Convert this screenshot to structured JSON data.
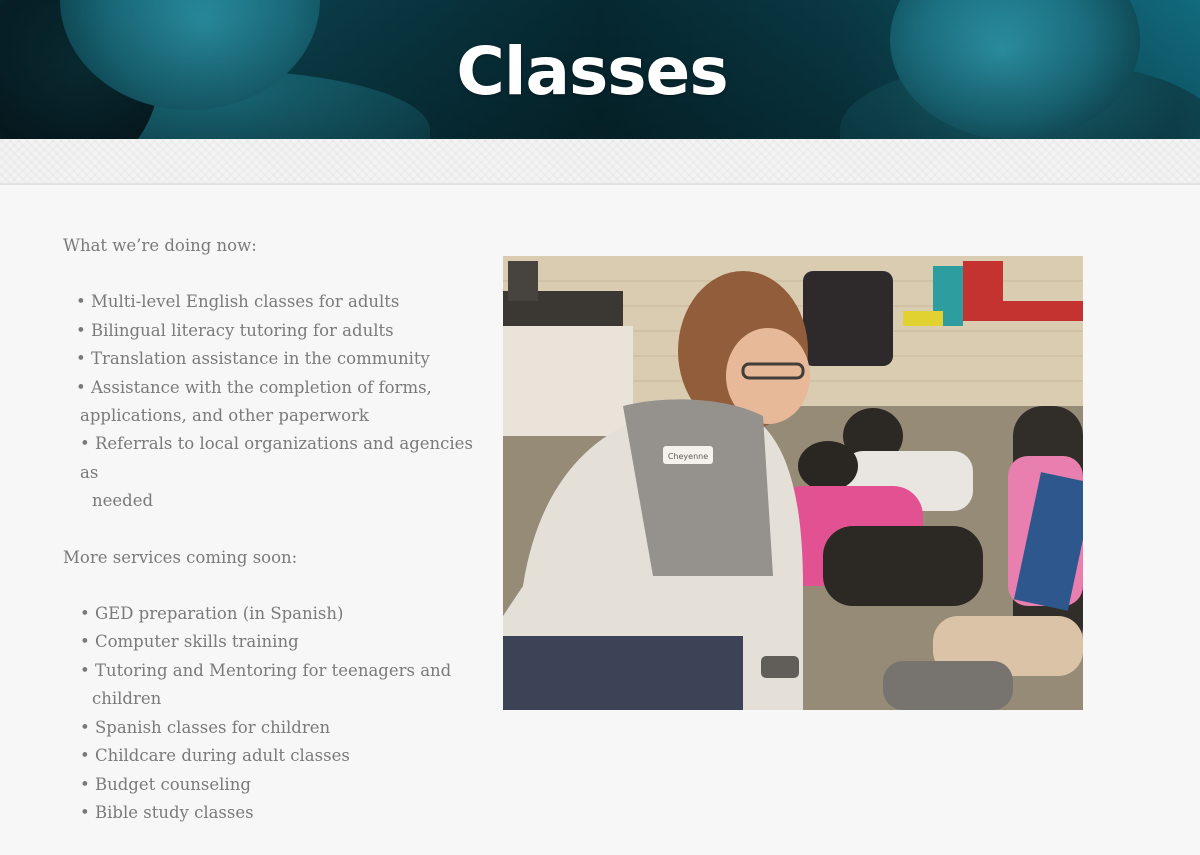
{
  "header": {
    "title": "Classes"
  },
  "sections": [
    {
      "heading": "What we’re doing now:",
      "items": [
        {
          "text": "• Multi-level English classes for adults"
        },
        {
          "text": "• Bilingual literacy tutoring for adults"
        },
        {
          "text": "• Translation assistance in the community"
        },
        {
          "text": "• Assistance with the completion of forms,",
          "wrap": "applications, and other paperwork"
        },
        {
          "text": "• Referrals to local organizations and agencies as",
          "wrap": "needed"
        }
      ]
    },
    {
      "heading": "More services coming soon:",
      "items": [
        {
          "text": "• GED preparation (in Spanish)"
        },
        {
          "text": "• Computer skills training"
        },
        {
          "text": "• Tutoring and Mentoring for teenagers and",
          "wrap": "children"
        },
        {
          "text": "• Spanish classes for children"
        },
        {
          "text": "• Childcare during adult classes"
        },
        {
          "text": "• Budget counseling"
        },
        {
          "text": "• Bible study classes"
        }
      ]
    }
  ],
  "photo": {
    "name_tag": "Cheyenne"
  },
  "colors": {
    "hero_teal": "#127084",
    "body_text": "#7a7a7a",
    "page_background": "#f7f7f7"
  }
}
